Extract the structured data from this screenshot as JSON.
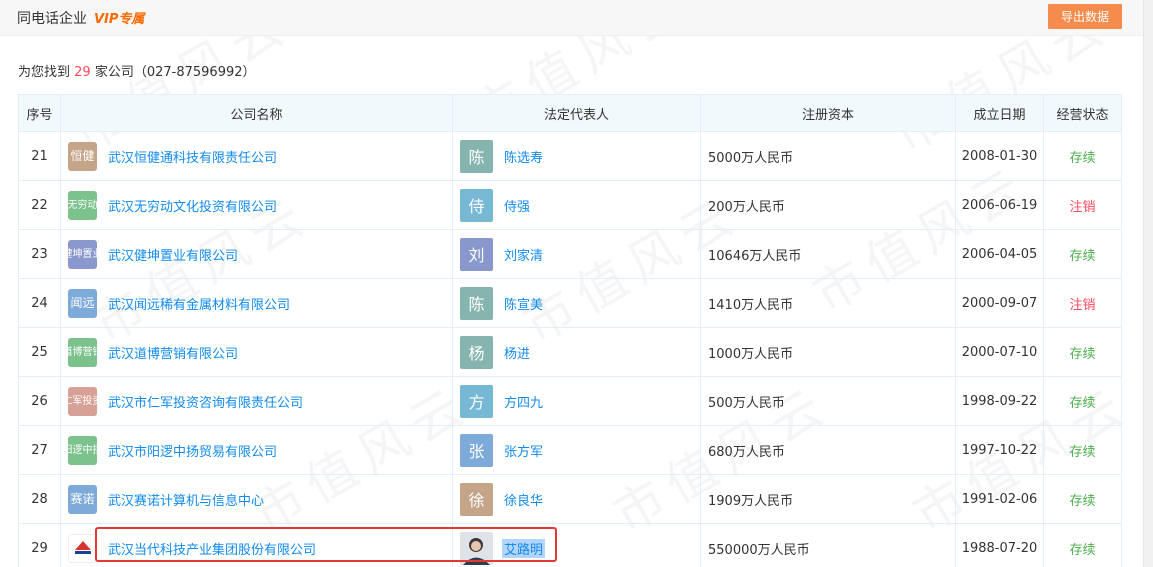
{
  "header": {
    "title": "同电话企业",
    "vip": "VIP专属",
    "export_label": "导出数据"
  },
  "summary": {
    "prefix": "为您找到",
    "count": "29",
    "suffix": "家公司（027-87596992）"
  },
  "columns": [
    "序号",
    "公司名称",
    "法定代表人",
    "注册资本",
    "成立日期",
    "经营状态"
  ],
  "rows": [
    {
      "idx": "21",
      "logo": "恒健",
      "logo_color": "#c4a589",
      "company": "武汉恒健通科技有限责任公司",
      "avatar": "陈",
      "avatar_color": "#86b4ae",
      "person": "陈选寿",
      "capital": "5000万人民币",
      "date": "2008-01-30",
      "status": "存续",
      "status_type": "ok"
    },
    {
      "idx": "22",
      "logo": "无穷动",
      "logo_color": "#7cc28c",
      "company": "武汉无穷动文化投资有限公司",
      "avatar": "侍",
      "avatar_color": "#77b8d4",
      "person": "侍强",
      "capital": "200万人民币",
      "date": "2006-06-19",
      "status": "注销",
      "status_type": "cancel"
    },
    {
      "idx": "23",
      "logo": "健坤置业",
      "logo_color": "#8a98ce",
      "company": "武汉健坤置业有限公司",
      "avatar": "刘",
      "avatar_color": "#8898cc",
      "person": "刘家清",
      "capital": "10646万人民币",
      "date": "2006-04-05",
      "status": "存续",
      "status_type": "ok"
    },
    {
      "idx": "24",
      "logo": "闻远",
      "logo_color": "#7daad8",
      "company": "武汉闻远稀有金属材料有限公司",
      "avatar": "陈",
      "avatar_color": "#86b4ae",
      "person": "陈宣美",
      "capital": "1410万人民币",
      "date": "2000-09-07",
      "status": "注销",
      "status_type": "cancel"
    },
    {
      "idx": "25",
      "logo": "道博营销",
      "logo_color": "#7cc28c",
      "company": "武汉道博营销有限公司",
      "avatar": "杨",
      "avatar_color": "#86b4ae",
      "person": "杨进",
      "capital": "1000万人民币",
      "date": "2000-07-10",
      "status": "存续",
      "status_type": "ok"
    },
    {
      "idx": "26",
      "logo": "仁军投资",
      "logo_color": "#d8a197",
      "company": "武汉市仁军投资咨询有限责任公司",
      "avatar": "方",
      "avatar_color": "#77b8d4",
      "person": "方四九",
      "capital": "500万人民币",
      "date": "1998-09-22",
      "status": "存续",
      "status_type": "ok"
    },
    {
      "idx": "27",
      "logo": "阳逻中扬",
      "logo_color": "#7cc28c",
      "company": "武汉市阳逻中扬贸易有限公司",
      "avatar": "张",
      "avatar_color": "#7daad8",
      "person": "张方军",
      "capital": "680万人民币",
      "date": "1997-10-22",
      "status": "存续",
      "status_type": "ok"
    },
    {
      "idx": "28",
      "logo": "赛诺",
      "logo_color": "#7daad8",
      "company": "武汉赛诺计算机与信息中心",
      "avatar": "徐",
      "avatar_color": "#c4a589",
      "person": "徐良华",
      "capital": "1909万人民币",
      "date": "1991-02-06",
      "status": "存续",
      "status_type": "ok"
    },
    {
      "idx": "29",
      "logo": "",
      "logo_color": "",
      "company": "武汉当代科技产业集团股份有限公司",
      "avatar": "",
      "avatar_color": "",
      "person": "艾路明",
      "capital": "550000万人民币",
      "date": "1988-07-20",
      "status": "存续",
      "status_type": "ok"
    }
  ],
  "colors": {
    "accent": "#128bed",
    "ok": "#4cae4c",
    "cancel": "#fd485e",
    "export": "#f58b4c",
    "highlight": "#e23a32"
  }
}
